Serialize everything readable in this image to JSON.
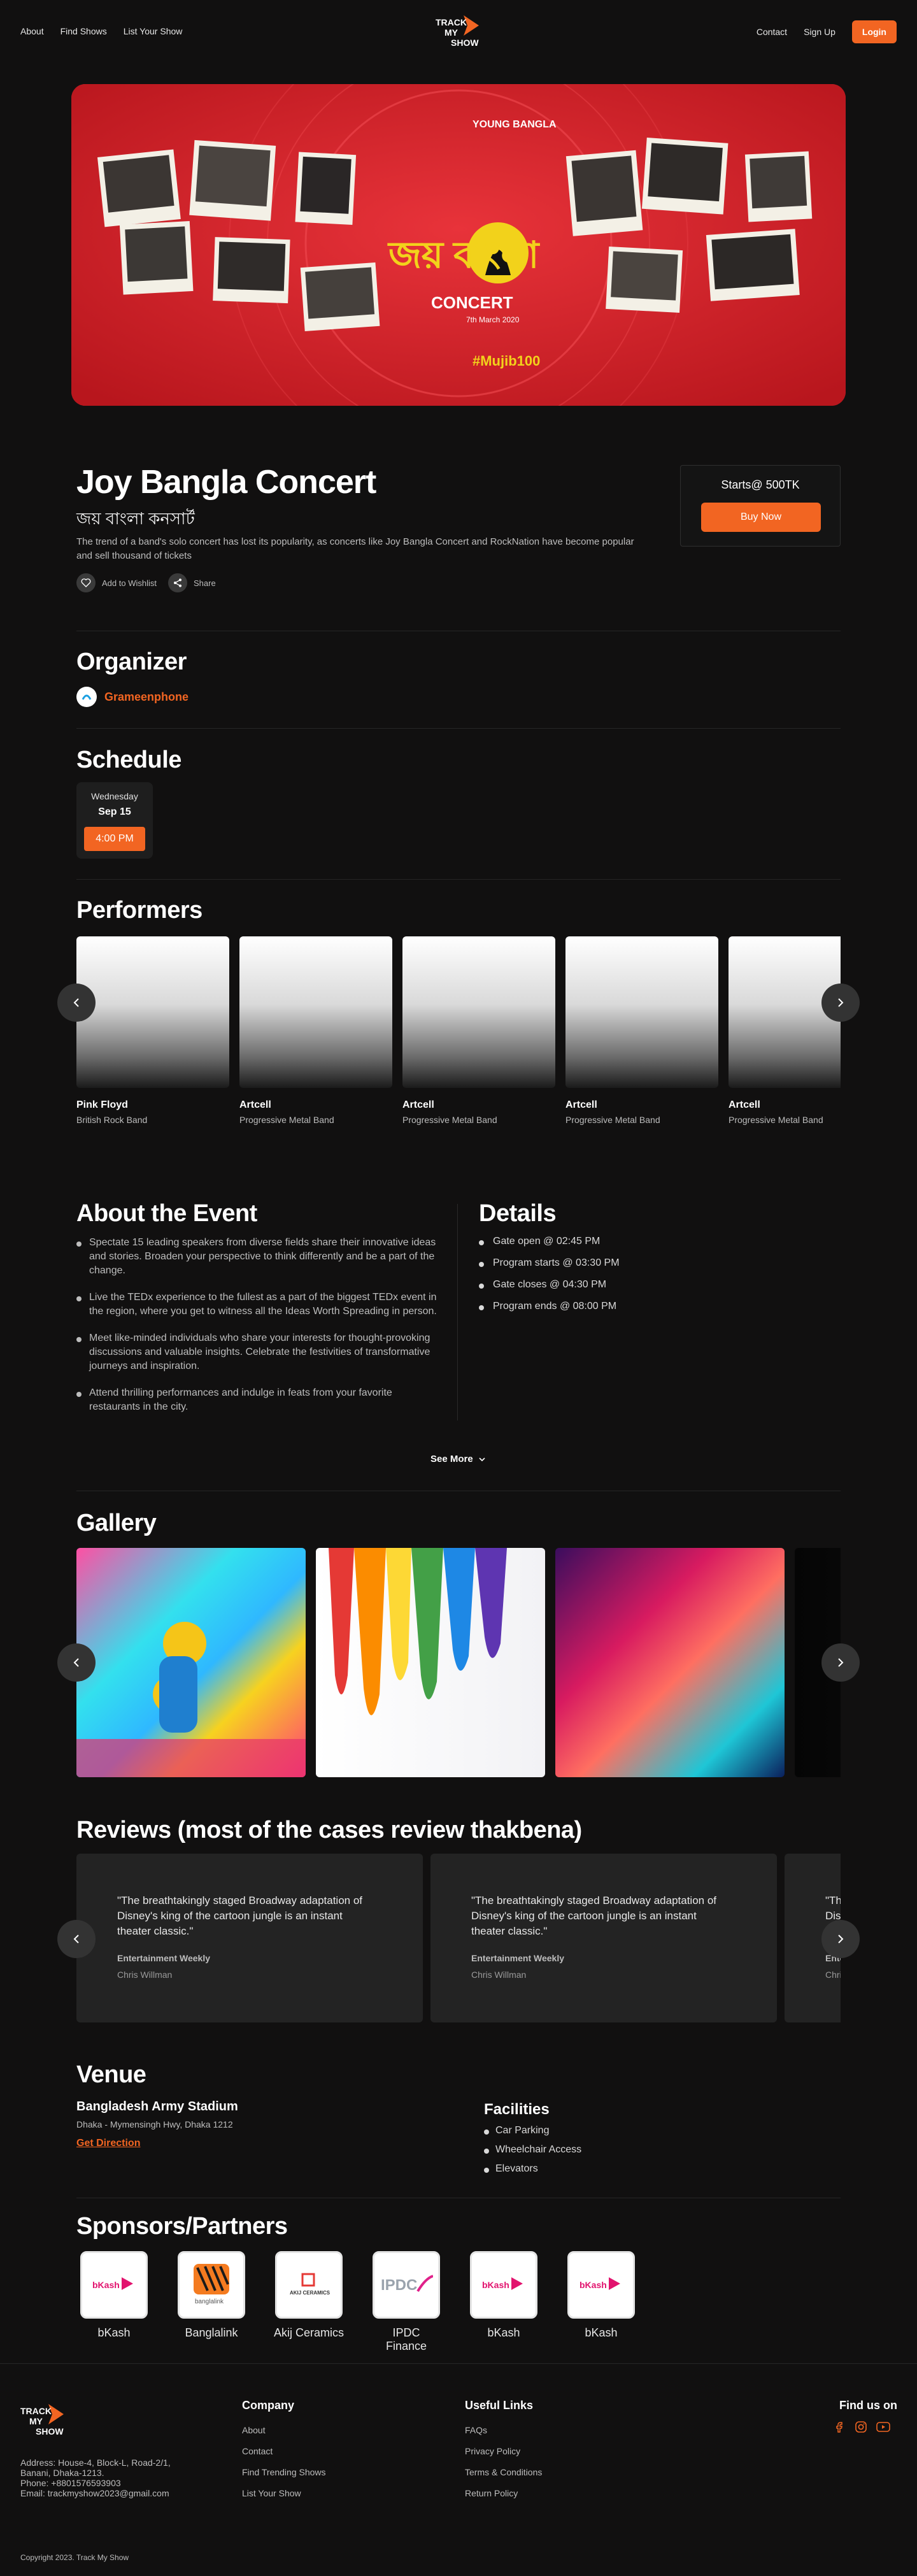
{
  "nav": {
    "links_left": [
      "About",
      "Find Shows",
      "List Your Show"
    ],
    "links_right": [
      "Contact",
      "Sign Up"
    ],
    "login_label": "Login",
    "logo_text": [
      "TRACK",
      "MY",
      "SHOW"
    ]
  },
  "hero": {
    "banner_title_bn": "জয় বাংলা",
    "banner_subtitle": "CONCERT",
    "banner_date": "7th March 2020",
    "banner_hashtag": "#Mujib100",
    "banner_tag": "YOUNG BANGLA"
  },
  "event": {
    "title": "Joy Bangla Concert",
    "title_bn": "জয় বাংলা কনসার্ট",
    "description": "The trend of a band's solo concert has lost its popularity, as concerts like Joy Bangla Concert and RockNation have become popular and sell thousand of tickets",
    "wishlist_label": "Add to Wishlist",
    "share_label": "Share",
    "price_label": "Starts@ 500TK",
    "buy_label": "Buy Now"
  },
  "organizer": {
    "section_title": "Organizer",
    "name": "Grameenphone"
  },
  "schedule": {
    "section_title": "Schedule",
    "day": "Wednesday",
    "date": "Sep 15",
    "time": "4:00 PM"
  },
  "performers": {
    "section_title": "Performers",
    "items": [
      {
        "name": "Pink Floyd",
        "genre": "British Rock Band"
      },
      {
        "name": "Artcell",
        "genre": "Progressive Metal Band"
      },
      {
        "name": "Artcell",
        "genre": "Progressive Metal Band"
      },
      {
        "name": "Artcell",
        "genre": "Progressive Metal Band"
      },
      {
        "name": "Artcell",
        "genre": "Progressive Metal Band"
      }
    ]
  },
  "about": {
    "section_title": "About the Event",
    "points": [
      "Spectate 15 leading speakers from diverse fields share their innovative ideas and stories. Broaden your perspective to think differently and be a part of the change.",
      "Live the TEDx experience to the fullest as a part of the biggest TEDx event in the region, where you get to witness all the Ideas Worth Spreading in person.",
      "Meet like-minded individuals who share your interests for thought-provoking discussions and valuable insights. Celebrate the festivities of transformative journeys and inspiration.",
      "Attend thrilling performances and indulge in feats from your favorite restaurants in the city."
    ],
    "see_more_label": "See More"
  },
  "details": {
    "section_title": "Details",
    "items": [
      "Gate open @ 02:45 PM",
      "Program starts @ 03:30 PM",
      "Gate closes @ 04:30 PM",
      "Program ends @ 08:00 PM"
    ]
  },
  "gallery": {
    "section_title": "Gallery"
  },
  "reviews": {
    "section_title": "Reviews (most of the cases review thakbena)",
    "items": [
      {
        "quote": "\"The breathtakingly staged Broadway adaptation of Disney's king of the cartoon jungle is an instant theater classic.\"",
        "source": "Entertainment Weekly",
        "author": "Chris Willman"
      },
      {
        "quote": "\"The breathtakingly staged Broadway adaptation of Disney's king of the cartoon jungle is an instant theater classic.\"",
        "source": "Entertainment Weekly",
        "author": "Chris Willman"
      },
      {
        "quote": "\"The breathtakingly staged Broadway adaptation of Disney's king of the cartoon jungle is an instant theater classic.\"",
        "source": "Entertainment Weekly",
        "author": "Chris Willman"
      }
    ]
  },
  "venue": {
    "section_title": "Venue",
    "name": "Bangladesh Army Stadium",
    "address": "Dhaka - Mymensingh Hwy, Dhaka 1212",
    "direction_label": "Get Direction",
    "facilities_title": "Facilities",
    "facilities": [
      "Car Parking",
      "Wheelchair Access",
      "Elevators"
    ]
  },
  "sponsors": {
    "section_title": "Sponsors/Partners",
    "items": [
      {
        "name": "bKash",
        "logo_text": "bKash"
      },
      {
        "name": "Banglalink",
        "logo_text": "banglalink"
      },
      {
        "name": "Akij Ceramics",
        "logo_text": "AKIJ CERAMICS"
      },
      {
        "name": "IPDC Finance",
        "logo_text": "IPDC"
      },
      {
        "name": "bKash",
        "logo_text": "bKash"
      },
      {
        "name": "bKash",
        "logo_text": "bKash"
      }
    ]
  },
  "footer": {
    "address_lines": [
      "Address: House-4, Block-L, Road-2/1,",
      "Banani, Dhaka-1213.",
      "Phone:  +8801576593903",
      "Email:  trackmyshow2023@gmail.com"
    ],
    "company_title": "Company",
    "company_links": [
      "About",
      "Contact",
      "Find Trending Shows",
      "List Your Show"
    ],
    "useful_title": "Useful Links",
    "useful_links": [
      "FAQs",
      "Privacy Policy",
      "Terms & Conditions",
      "Return Policy"
    ],
    "find_us_title": "Find us on",
    "copyright": "Copyright 2023. Track My Show"
  },
  "colors": {
    "accent": "#f26522",
    "background": "#111010",
    "card": "#232323",
    "banner_red": "#d7262d"
  }
}
